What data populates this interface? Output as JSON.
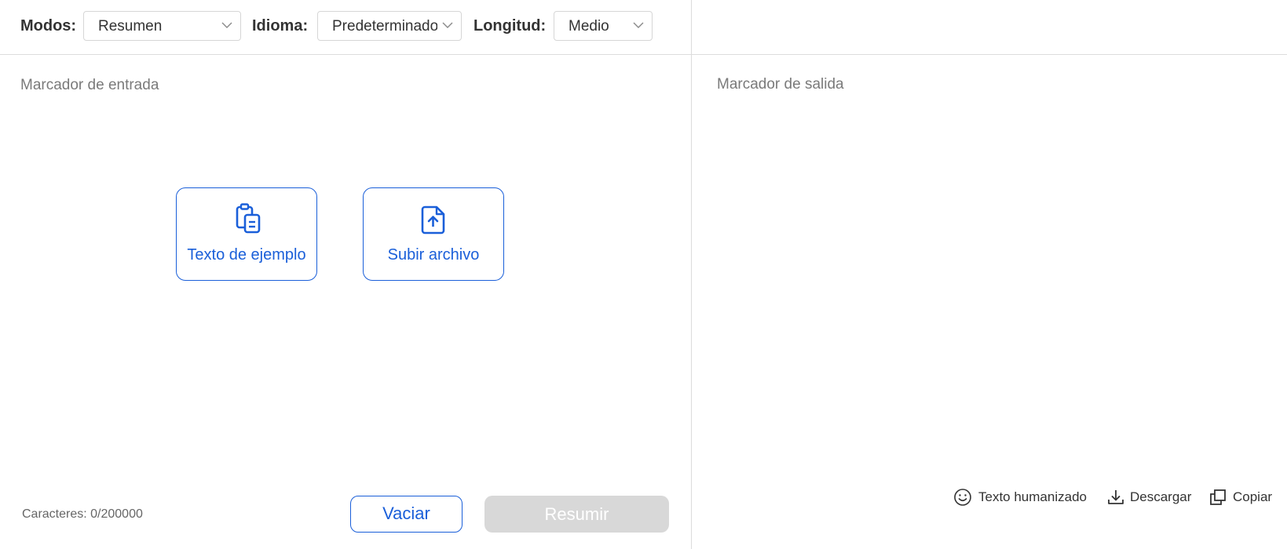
{
  "toolbar": {
    "modes_label": "Modos:",
    "modes_value": "Resumen",
    "language_label": "Idioma:",
    "language_value": "Predeterminado",
    "length_label": "Longitud:",
    "length_value": "Medio"
  },
  "input": {
    "placeholder": "Marcador de entrada",
    "sample_text_label": "Texto de ejemplo",
    "upload_file_label": "Subir archivo",
    "char_count": "Caracteres: 0/200000",
    "clear_label": "Vaciar",
    "summarize_label": "Resumir"
  },
  "output": {
    "placeholder": "Marcador de salida",
    "humanize_label": "Texto humanizado",
    "download_label": "Descargar",
    "copy_label": "Copiar"
  },
  "icons": {
    "sample": "clipboard-icon",
    "upload": "file-upload-icon",
    "humanize": "smiley-icon",
    "download": "download-icon",
    "copy": "copy-icon",
    "chevron": "chevron-down-icon"
  },
  "colors": {
    "accent": "#1a5fd9",
    "disabled_button": "#d8d8d8",
    "divider": "#dcdcdc",
    "placeholder_text": "#7a7a7a"
  }
}
